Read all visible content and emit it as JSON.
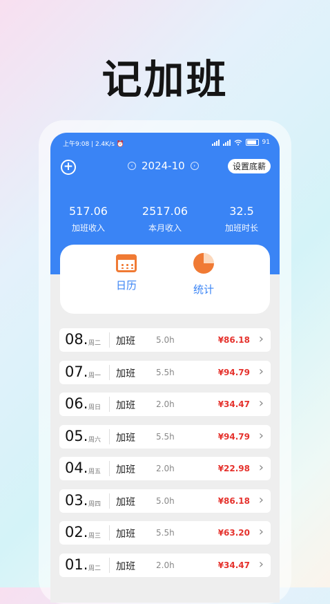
{
  "headline": "记加班",
  "status_bar": {
    "left": "上午9:08 | 2.4K/s ⏰",
    "battery": "91"
  },
  "toolbar": {
    "month": "2024-10",
    "prev_arrow": "‹",
    "next_arrow": "›",
    "set_salary": "设置底薪",
    "add_symbol": "+"
  },
  "summary": [
    {
      "value": "517.06",
      "label": "加班收入"
    },
    {
      "value": "2517.06",
      "label": "本月收入"
    },
    {
      "value": "32.5",
      "label": "加班时长"
    }
  ],
  "tabs": [
    {
      "label": "日历",
      "icon": "calendar-icon"
    },
    {
      "label": "统计",
      "icon": "pie-chart-icon"
    }
  ],
  "colors": {
    "accent": "#3a84f5",
    "icon_orange": "#f07a34",
    "amount_red": "#e5322d"
  },
  "records": [
    {
      "day": "08.",
      "weekday": "周二",
      "kind": "加班",
      "hours": "5.0h",
      "amount": "¥86.18"
    },
    {
      "day": "07.",
      "weekday": "周一",
      "kind": "加班",
      "hours": "5.5h",
      "amount": "¥94.79"
    },
    {
      "day": "06.",
      "weekday": "周日",
      "kind": "加班",
      "hours": "2.0h",
      "amount": "¥34.47"
    },
    {
      "day": "05.",
      "weekday": "周六",
      "kind": "加班",
      "hours": "5.5h",
      "amount": "¥94.79"
    },
    {
      "day": "04.",
      "weekday": "周五",
      "kind": "加班",
      "hours": "2.0h",
      "amount": "¥22.98"
    },
    {
      "day": "03.",
      "weekday": "周四",
      "kind": "加班",
      "hours": "5.0h",
      "amount": "¥86.18"
    },
    {
      "day": "02.",
      "weekday": "周三",
      "kind": "加班",
      "hours": "5.5h",
      "amount": "¥63.20"
    },
    {
      "day": "01.",
      "weekday": "周二",
      "kind": "加班",
      "hours": "2.0h",
      "amount": "¥34.47"
    }
  ]
}
